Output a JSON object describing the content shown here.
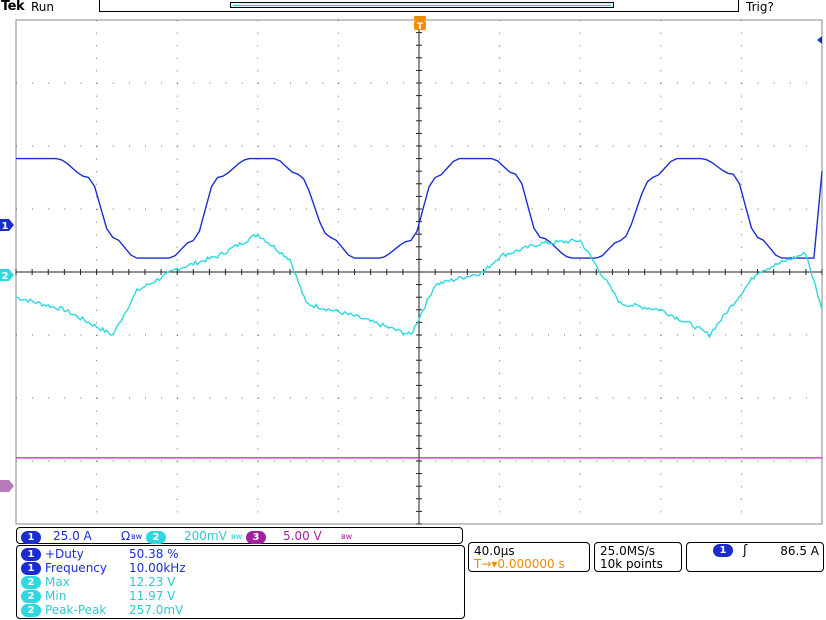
{
  "header": {
    "brand": "Tek",
    "status": "Run",
    "trigger_status": "Trig?"
  },
  "channels": [
    {
      "number": "1",
      "scale": "25.0 A",
      "coupling": "Ω",
      "bw_flag": "ʙᴡ",
      "color": "#1a2ed0"
    },
    {
      "number": "2",
      "scale": "200mV",
      "bw_flag": "ʙᴡ",
      "color": "#2fd8e0"
    },
    {
      "number": "3",
      "scale": "5.00 V",
      "bw_flag": "ʙᴡ",
      "color": "#a020a0"
    }
  ],
  "markers": {
    "ch1_ground": "1",
    "ch2_ground": "2",
    "trigger_point": "T"
  },
  "measurements": [
    {
      "channel": "1",
      "name": "+Duty",
      "value": "50.38 %"
    },
    {
      "channel": "1",
      "name": "Frequency",
      "value": "10.00kHz"
    },
    {
      "channel": "2",
      "name": "Max",
      "value": "12.23 V"
    },
    {
      "channel": "2",
      "name": "Min",
      "value": "11.97 V"
    },
    {
      "channel": "2",
      "name": "Peak-Peak",
      "value": "257.0mV"
    }
  ],
  "timebase": {
    "scale": "40.0µs",
    "position_prefix": "T→▾",
    "position": "0.000000 s"
  },
  "acquisition": {
    "sample_rate": "25.0MS/s",
    "record_length": "10k points"
  },
  "trigger": {
    "source": "1",
    "slope_symbol": "ʃ",
    "level": "86.5 A"
  },
  "colors": {
    "ch1": "#1a2ed0",
    "ch2": "#2fd8e0",
    "ch3": "#c020c0",
    "trigger_orange": "#f08c00",
    "grid": "#555555"
  },
  "chart_data": {
    "type": "line",
    "xlabel": "",
    "ylabel": "",
    "x_divisions": 10,
    "y_divisions": 8,
    "x_per_div": "40.0µs",
    "grid": true,
    "series": [
      {
        "name": "1",
        "x_div": [
          0.0,
          0.5,
          0.9,
          1.2,
          1.5,
          1.9,
          2.2,
          2.5,
          2.9,
          3.2,
          3.5,
          3.9,
          4.2,
          4.5,
          4.9,
          5.2,
          5.5,
          5.9,
          6.2,
          6.5,
          6.9,
          7.2,
          7.5,
          7.9,
          8.2,
          8.5,
          8.9,
          9.2,
          9.5,
          9.9,
          10.0
        ],
        "y_div": [
          1.8,
          1.8,
          1.5,
          0.55,
          0.22,
          0.22,
          0.5,
          1.5,
          1.8,
          1.8,
          1.55,
          0.55,
          0.22,
          0.22,
          0.5,
          1.5,
          1.8,
          1.8,
          1.55,
          0.55,
          0.22,
          0.22,
          0.5,
          1.5,
          1.8,
          1.8,
          1.55,
          0.55,
          0.22,
          0.22,
          1.6
        ]
      },
      {
        "name": "2",
        "x_div": [
          0.0,
          0.6,
          1.2,
          1.5,
          2.0,
          2.5,
          3.0,
          3.4,
          3.6,
          4.2,
          4.9,
          5.2,
          5.8,
          6.0,
          6.5,
          7.0,
          7.5,
          8.0,
          8.4,
          8.6,
          9.2,
          9.8,
          10.0
        ],
        "y_div": [
          -0.4,
          -0.6,
          -1.0,
          -0.3,
          0.05,
          0.25,
          0.6,
          0.2,
          -0.5,
          -0.7,
          -1.0,
          -0.2,
          0.0,
          0.25,
          0.45,
          0.5,
          -0.5,
          -0.6,
          -0.85,
          -1.0,
          0.0,
          0.3,
          -0.6
        ]
      },
      {
        "name": "3",
        "x_div": [
          0.0,
          10.0
        ],
        "y_div": [
          -2.95,
          -2.95
        ]
      }
    ]
  }
}
